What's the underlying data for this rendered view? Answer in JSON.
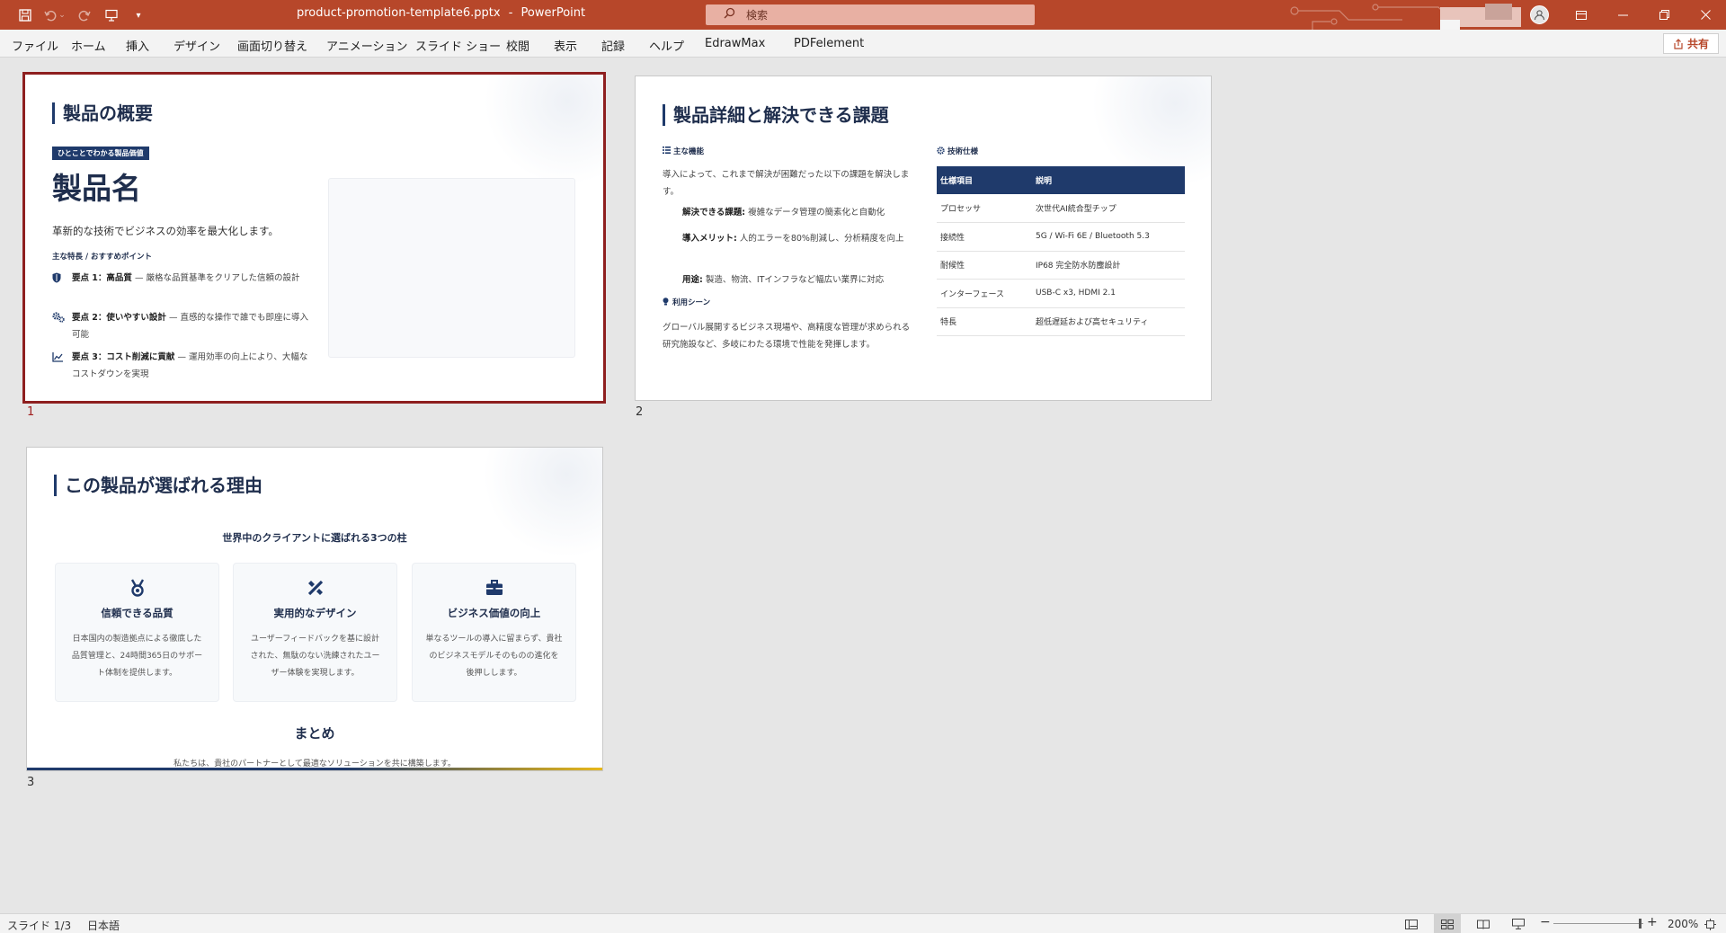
{
  "titlebar": {
    "filename": "product-promotion-template6.pptx",
    "separator": "-",
    "app": "PowerPoint",
    "search_placeholder": "検索",
    "accent": "#b7472a"
  },
  "menu": [
    "ファイル",
    "ホーム",
    "挿入",
    "デザイン",
    "画面切り替え",
    "アニメーション",
    "スライド ショー",
    "校閲",
    "表示",
    "記録",
    "ヘルプ",
    "EdrawMax",
    "PDFelement"
  ],
  "share_label": "共有",
  "slides": [
    {
      "number": "1",
      "title": "製品の概要",
      "tag": "ひとことでわかる製品価値",
      "product_name": "製品名",
      "description": "革新的な技術でビジネスの効率を最大化します。",
      "subheading": "主な特長 / おすすめポイント",
      "points": [
        {
          "icon": "shield-icon",
          "label": "要点 1：高品質",
          "text": " — 厳格な品質基準をクリアした信頼の設計"
        },
        {
          "icon": "gears-icon",
          "label": "要点 2：使いやすい設計",
          "text": " — 直感的な操作で誰でも即座に導入可能"
        },
        {
          "icon": "chart-line-icon",
          "label": "要点 3：コスト削減に貢献",
          "text": " — 運用効率の向上により、大幅なコストダウンを実現"
        }
      ]
    },
    {
      "number": "2",
      "title": "製品詳細と解決できる課題",
      "features_heading": "主な機能",
      "features_intro": "導入によって、これまで解決が困難だった以下の課題を解決します。",
      "items": [
        {
          "label": "解決できる課題:",
          "text": " 複雑なデータ管理の簡素化と自動化"
        },
        {
          "label": "導入メリット:",
          "text": " 人的エラーを80%削減し、分析精度を向上"
        },
        {
          "label": "用途:",
          "text": " 製造、物流、ITインフラなど幅広い業界に対応"
        }
      ],
      "scene_heading": "利用シーン",
      "scene_text": "グローバル展開するビジネス現場や、高精度な管理が求められる研究施設など、多岐にわたる環境で性能を発揮します。",
      "spec_heading": "技術仕様",
      "spec_header": [
        "仕様項目",
        "説明"
      ],
      "spec_rows": [
        [
          "プロセッサ",
          "次世代AI統合型チップ"
        ],
        [
          "接続性",
          "5G / Wi-Fi 6E / Bluetooth 5.3"
        ],
        [
          "耐候性",
          "IP68 完全防水防塵設計"
        ],
        [
          "インターフェース",
          "USB-C x3, HDMI 2.1"
        ],
        [
          "特長",
          "超低遅延および高セキュリティ"
        ]
      ]
    },
    {
      "number": "3",
      "title": "この製品が選ばれる理由",
      "subtitle": "世界中のクライアントに選ばれる3つの柱",
      "cards": [
        {
          "icon": "medal-icon",
          "title": "信頼できる品質",
          "text": "日本国内の製造拠点による徹底した品質管理と、24時間365日のサポート体制を提供します。"
        },
        {
          "icon": "design-tools-icon",
          "title": "実用的なデザイン",
          "text": "ユーザーフィードバックを基に設計された、無駄のない洗練されたユーザー体験を実現します。"
        },
        {
          "icon": "briefcase-icon",
          "title": "ビジネス価値の向上",
          "text": "単なるツールの導入に留まらず、貴社のビジネスモデルそのものの進化を後押しします。"
        }
      ],
      "summary_title": "まとめ",
      "summary_text": "私たちは、貴社のパートナーとして最適なソリューションを共に構築します。"
    }
  ],
  "status": {
    "slide_indicator": "スライド 1/3",
    "language": "日本語",
    "zoom": "200%"
  }
}
